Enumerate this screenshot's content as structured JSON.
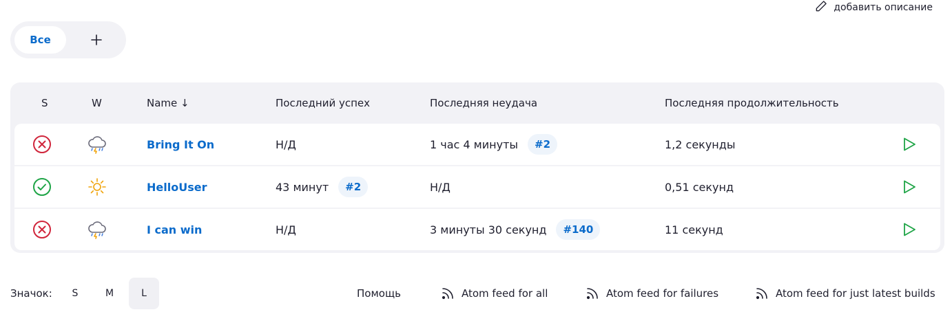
{
  "header": {
    "add_description": "добавить описание"
  },
  "tabs": {
    "all_label": "Все",
    "add_label": "+"
  },
  "table": {
    "columns": {
      "s": "S",
      "w": "W",
      "name": "Name ↓",
      "last_success": "Последний успех",
      "last_failure": "Последняя неудача",
      "last_duration": "Последняя продолжительность"
    },
    "rows": [
      {
        "status": "failed",
        "weather": "storm",
        "name": "Bring It On",
        "last_success": "Н/Д",
        "last_success_build": "",
        "last_failure": "1 час 4 минуты",
        "last_failure_build": "#2",
        "duration": "1,2 секунды"
      },
      {
        "status": "success",
        "weather": "sunny",
        "name": "HelloUser",
        "last_success": "43 минут",
        "last_success_build": "#2",
        "last_failure": "Н/Д",
        "last_failure_build": "",
        "duration": "0,51 секунд"
      },
      {
        "status": "failed",
        "weather": "storm",
        "name": "I can win",
        "last_success": "Н/Д",
        "last_success_build": "",
        "last_failure": "3 минуты 30 секунд",
        "last_failure_build": "#140",
        "duration": "11 секунд"
      }
    ]
  },
  "footer": {
    "icon_label": "Значок:",
    "sizes": [
      "S",
      "M",
      "L"
    ],
    "active_size": "L",
    "help": "Помощь",
    "feed_all": "Atom feed for all",
    "feed_failures": "Atom feed for failures",
    "feed_latest": "Atom feed for just latest builds"
  },
  "colors": {
    "link": "#0b6bcb",
    "failed": "#d0253b",
    "success": "#1ea446",
    "run": "#1ea446",
    "panel_bg": "#f2f2f6"
  }
}
